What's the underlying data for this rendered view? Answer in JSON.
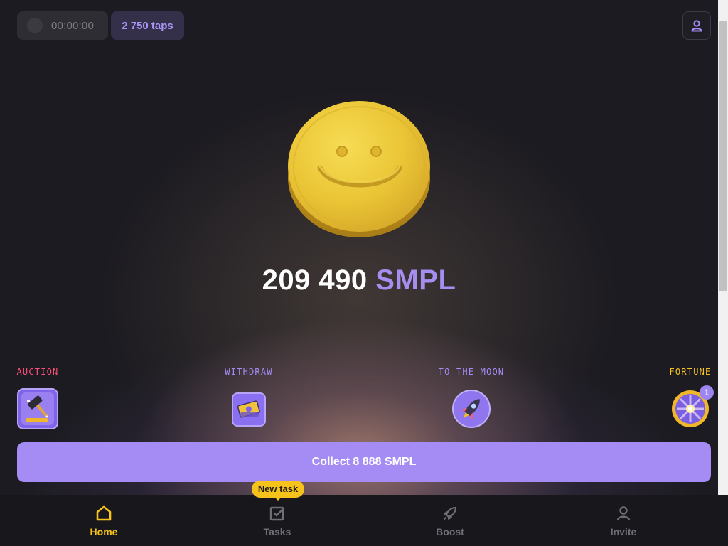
{
  "header": {
    "timer": "00:00:00",
    "taps": "2 750 taps",
    "profile_icon": "user-icon"
  },
  "balance": {
    "amount": "209 490",
    "currency": "SMPL"
  },
  "features": [
    {
      "label": "AUCTION",
      "icon": "gavel-icon",
      "color": "#ff4f7a"
    },
    {
      "label": "WITHDRAW",
      "icon": "money-icon",
      "color": "#a48cf4"
    },
    {
      "label": "TO THE MOON",
      "icon": "rocket-icon",
      "color": "#a48cf4"
    },
    {
      "label": "FORTUNE",
      "icon": "wheel-icon",
      "color": "#f6c21c",
      "badge": "1"
    }
  ],
  "collect_button": "Collect 8 888 SMPL",
  "nav": {
    "items": [
      {
        "label": "Home",
        "icon": "home-icon",
        "active": true
      },
      {
        "label": "Tasks",
        "icon": "checkbox-icon",
        "active": false
      },
      {
        "label": "Boost",
        "icon": "rocket-icon",
        "active": false
      },
      {
        "label": "Invite",
        "icon": "user-icon",
        "active": false
      }
    ],
    "tasks_tooltip": "New task"
  },
  "colors": {
    "accent": "#a48cf4",
    "active": "#f6c21c",
    "coin": "#e9c438"
  }
}
